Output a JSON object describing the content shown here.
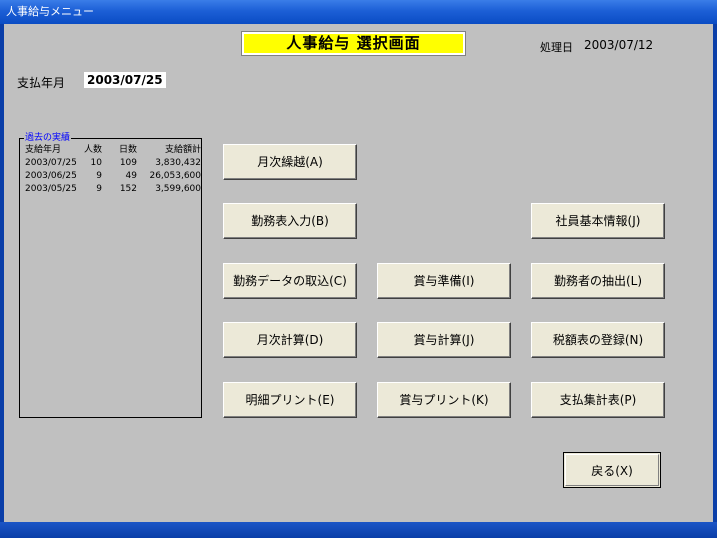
{
  "window": {
    "title": "人事給与メニュー"
  },
  "header": {
    "screen_title": "人事給与  選択画面",
    "processing_date_label": "処理日",
    "processing_date": "2003/07/12"
  },
  "payment": {
    "label": "支払年月",
    "value": "2003/07/25"
  },
  "history": {
    "legend": "過去の実績",
    "columns": [
      "支給年月",
      "人数",
      "日数",
      "支給額計"
    ],
    "rows": [
      [
        "2003/07/25",
        "10",
        "109",
        "3,830,432"
      ],
      [
        "2003/06/25",
        "9",
        "49",
        "26,053,600"
      ],
      [
        "2003/05/25",
        "9",
        "152",
        "3,599,600"
      ]
    ]
  },
  "buttons": {
    "monthly_carryover": "月次繰越(A)",
    "attendance_input": "勤務表入力(B)",
    "employee_info": "社員基本情報(J)",
    "attendance_import": "勤務データの取込(C)",
    "bonus_prep": "賞与準備(I)",
    "worker_extract": "勤務者の抽出(L)",
    "monthly_calc": "月次計算(D)",
    "bonus_calc": "賞与計算(J)",
    "tax_table_register": "税額表の登録(N)",
    "statement_print": "明細プリント(E)",
    "bonus_print": "賞与プリント(K)",
    "payment_summary": "支払集計表(P)",
    "back": "戻る(X)"
  }
}
